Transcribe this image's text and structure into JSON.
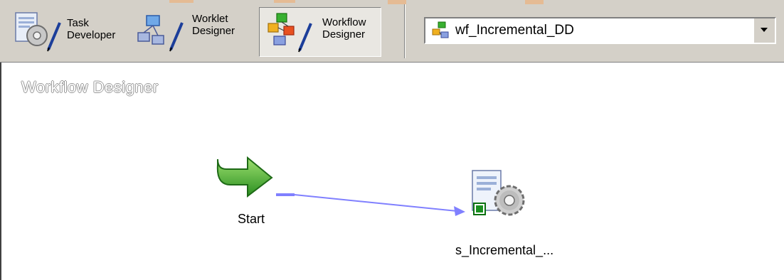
{
  "toolbar": {
    "buttons": [
      {
        "line1": "Task",
        "line2": "Developer",
        "icon": "task-developer-icon",
        "active": false
      },
      {
        "line1": "Worklet",
        "line2": "Designer",
        "icon": "worklet-designer-icon",
        "active": false
      },
      {
        "line1": "Workflow",
        "line2": "Designer",
        "icon": "workflow-designer-icon",
        "active": true
      }
    ],
    "workflow_select": {
      "value": "wf_Incremental_DD",
      "icon": "workflow-icon"
    }
  },
  "canvas": {
    "title": "Workflow Designer",
    "nodes": [
      {
        "label": "Start",
        "icon": "start-arrow-icon"
      },
      {
        "label": "s_Incremental_...",
        "icon": "session-gear-icon"
      }
    ],
    "link": {
      "from": "Start",
      "to": "s_Incremental_..."
    }
  },
  "colors": {
    "toolbar_bg": "#d4d0c8",
    "canvas_bg": "#ffffff",
    "link": "#8080ff",
    "start_green": "#3fae2a"
  }
}
